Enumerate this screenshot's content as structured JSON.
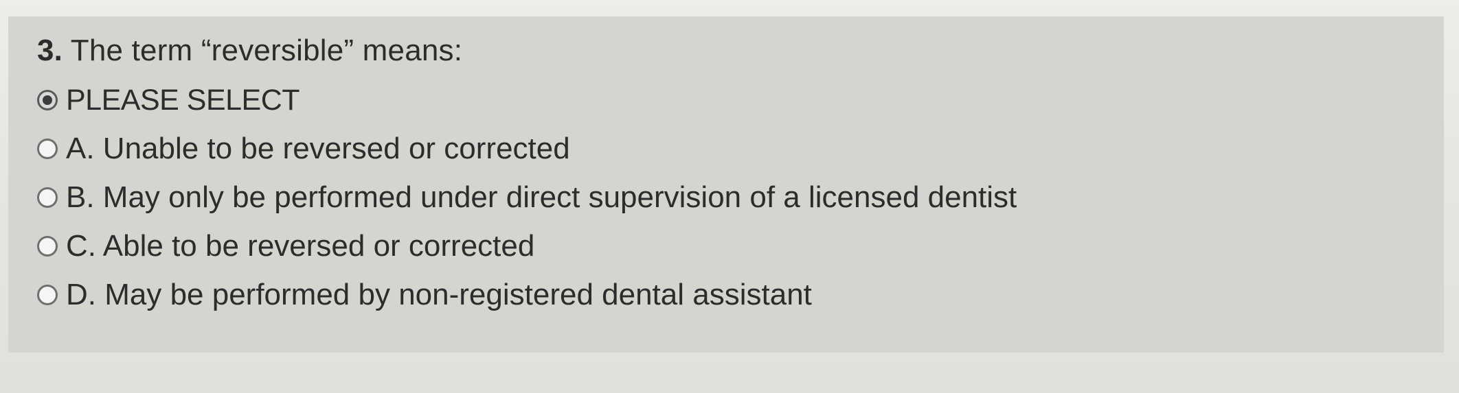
{
  "question": {
    "number": "3.",
    "text": "The term “reversible” means:"
  },
  "options": [
    {
      "label": "PLEASE SELECT",
      "selected": true
    },
    {
      "label": "A. Unable to be reversed or corrected",
      "selected": false
    },
    {
      "label": "B. May only be performed under direct supervision of a licensed dentist",
      "selected": false
    },
    {
      "label": "C. Able to be reversed or corrected",
      "selected": false
    },
    {
      "label": "D. May be performed by non-registered dental assistant",
      "selected": false
    }
  ]
}
